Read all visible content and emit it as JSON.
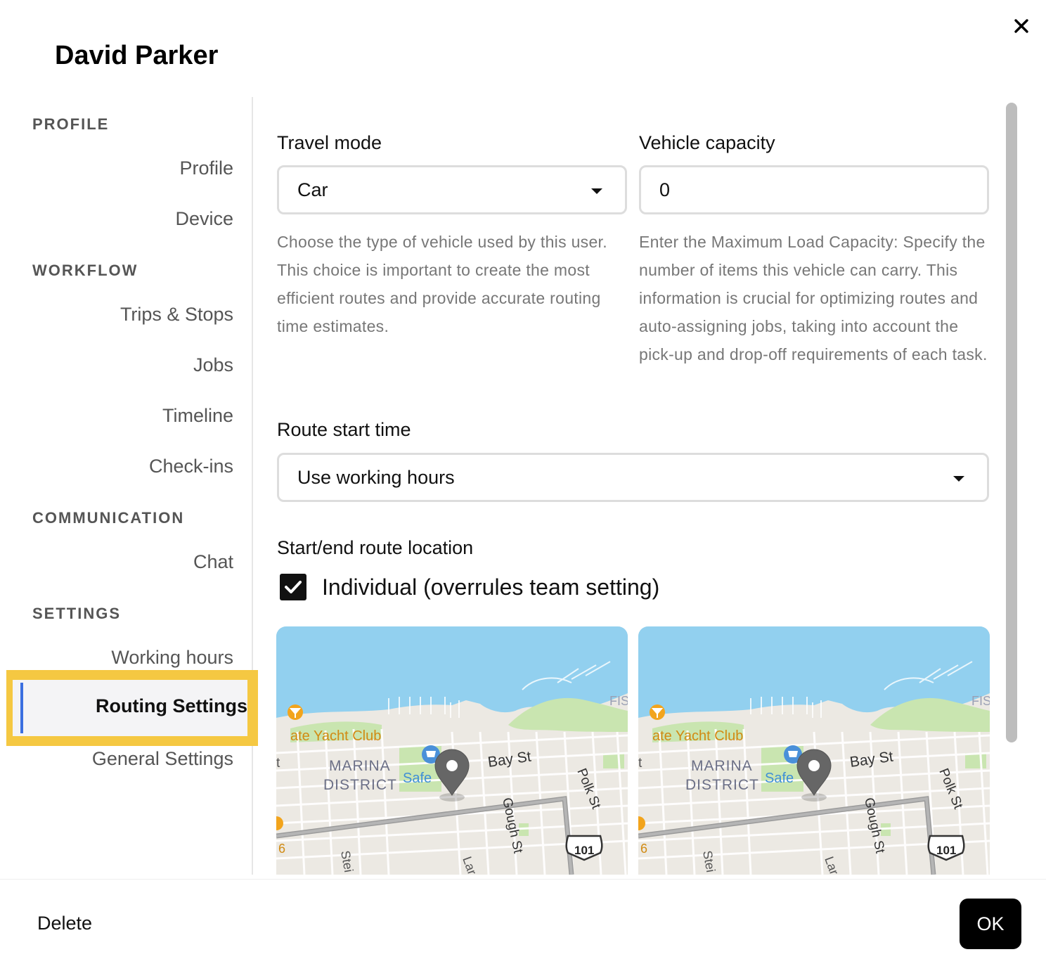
{
  "dialog": {
    "user_name": "David Parker"
  },
  "sidebar": {
    "sections": [
      {
        "heading": "PROFILE",
        "items": [
          "Profile",
          "Device"
        ]
      },
      {
        "heading": "WORKFLOW",
        "items": [
          "Trips & Stops",
          "Jobs",
          "Timeline",
          "Check-ins"
        ]
      },
      {
        "heading": "COMMUNICATION",
        "items": [
          "Chat"
        ]
      },
      {
        "heading": "SETTINGS",
        "items": [
          "Working hours",
          "Routing Settings",
          "General Settings"
        ]
      }
    ],
    "active_item": "Routing Settings"
  },
  "routing": {
    "travel_mode": {
      "label": "Travel mode",
      "value": "Car",
      "help": "Choose the type of vehicle used by this user. This choice is important to create the most efficient routes and provide accurate routing time estimates."
    },
    "vehicle_capacity": {
      "label": "Vehicle capacity",
      "value": "0",
      "help": "Enter the Maximum Load Capacity: Specify the number of items this vehicle can carry. This information is crucial for optimizing routes and auto-assigning jobs, taking into account the pick-up and drop-off requirements of each task."
    },
    "route_start_time": {
      "label": "Route start time",
      "value": "Use working hours"
    },
    "start_end_location": {
      "label": "Start/end route location",
      "checkbox_label": "Individual (overrules team setting)",
      "checked": true
    },
    "map": {
      "labels": {
        "yacht_club": "ate Yacht Club",
        "marina": "MARINA",
        "district": "DISTRICT",
        "safeway": "Safe",
        "bay_st": "Bay St",
        "gough_st": "Gough St",
        "polk_st": "Polk St",
        "highway": "101",
        "fis": "FIS",
        "stei": "Stei",
        "lar": "Lar",
        "left_t": "t",
        "left_6": "6"
      }
    }
  },
  "footer": {
    "delete_label": "Delete",
    "ok_label": "OK"
  },
  "colors": {
    "highlight": "#f5c842",
    "active_bar": "#3b6fe0",
    "water": "#92d0ef",
    "park": "#c9e5b0",
    "land": "#ece9e3"
  }
}
